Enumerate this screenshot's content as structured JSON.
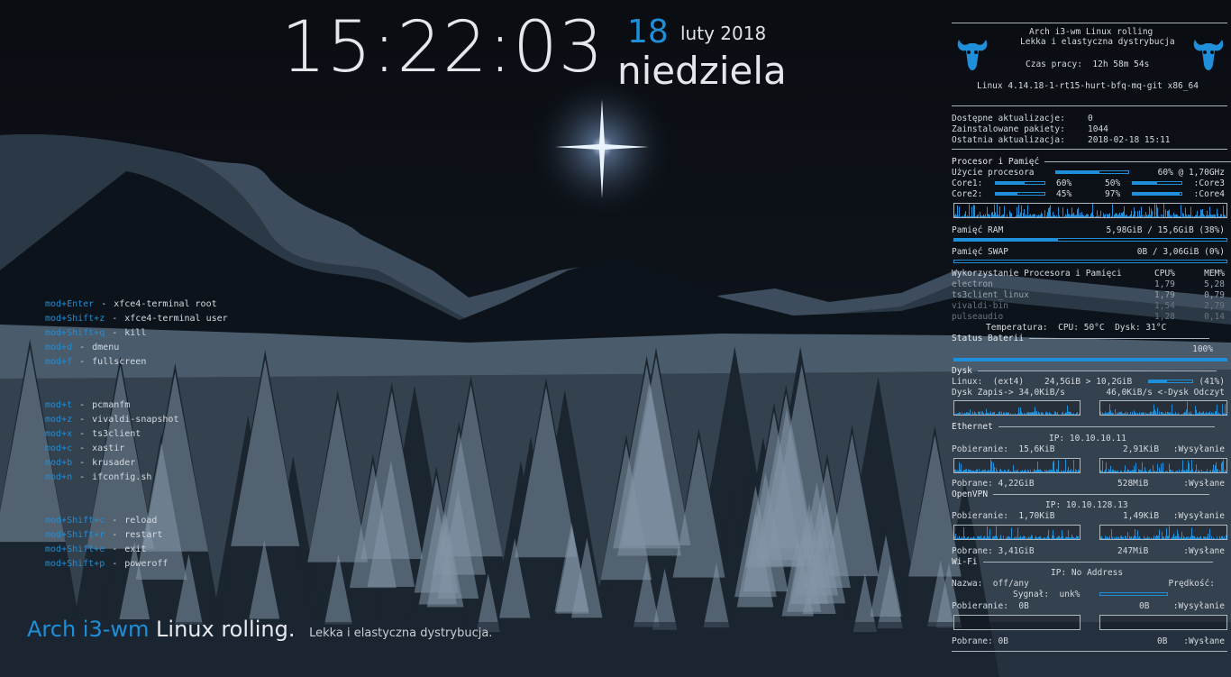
{
  "clock": {
    "time": "15:22:03",
    "day": "18",
    "month_year": "luty 2018",
    "weekday": "niedziela"
  },
  "keybinds": [
    {
      "key": "mod+Enter",
      "sep": "-",
      "desc": "xfce4-terminal root"
    },
    {
      "key": "mod+Shift+z",
      "sep": "-",
      "desc": "xfce4-terminal user"
    },
    {
      "key": "mod+Shift+q",
      "sep": "-",
      "desc": "kill"
    },
    {
      "key": "mod+d",
      "sep": "-",
      "desc": "dmenu"
    },
    {
      "key": "mod+f",
      "sep": "-",
      "desc": "fullscreen"
    },
    {
      "key": "mod+t",
      "sep": "-",
      "desc": "pcmanfm"
    },
    {
      "key": "mod+z",
      "sep": "-",
      "desc": "vivaldi-snapshot"
    },
    {
      "key": "mod+x",
      "sep": "-",
      "desc": "ts3client"
    },
    {
      "key": "mod+c",
      "sep": "-",
      "desc": "xastir"
    },
    {
      "key": "mod+b",
      "sep": "-",
      "desc": "krusader"
    },
    {
      "key": "mod+n",
      "sep": "-",
      "desc": "ifconfig.sh"
    },
    {
      "key": "mod+Shift+c",
      "sep": "-",
      "desc": "reload"
    },
    {
      "key": "mod+Shift+r",
      "sep": "-",
      "desc": "restart"
    },
    {
      "key": "mod+Shift+e",
      "sep": "-",
      "desc": "exit"
    },
    {
      "key": "mod+Shift+p",
      "sep": "-",
      "desc": "poweroff"
    }
  ],
  "bottom_title": {
    "a": "Arch i3-wm",
    "b": "Linux rolling.",
    "c": "Lekka i elastyczna dystrybucja."
  },
  "conky": {
    "header": {
      "line1": "Arch i3-wm Linux rolling",
      "line2": "Lekka i elastyczna dystrybucja",
      "uptime_label": "Czas pracy:",
      "uptime": "12h 58m 54s",
      "kernel": "Linux 4.14.18-1-rt15-hurt-bfq-mq-git x86_64"
    },
    "updates": {
      "available_label": "Dostępne aktualizacje:",
      "available": "0",
      "installed_label": "Zainstalowane pakiety:",
      "installed": "1044",
      "last_label": "Ostatnia aktualizacja:",
      "last": "2018-02-18 15:11"
    },
    "cpu": {
      "title": "Procesor i Pamięć",
      "usage_label": "Użycie procesora",
      "usage": "60% @ 1,70GHz",
      "usage_frac": 0.6,
      "core1_label": "Core1:",
      "core1": "60%",
      "core1_frac": 0.6,
      "core3": "50%",
      "core3_frac": 0.5,
      "core3_label": ":Core3",
      "core2_label": "Core2:",
      "core2": "45%",
      "core2_frac": 0.45,
      "core4": "97%",
      "core4_frac": 0.97,
      "core4_label": ":Core4"
    },
    "ram": {
      "label": "Pamięć RAM",
      "value": "5,98GiB / 15,6GiB (38%)",
      "frac": 0.38
    },
    "swap": {
      "label": "Pamięć SWAP",
      "value": "0B  / 3,06GiB (0%)",
      "frac": 0.0
    },
    "procs": {
      "title": "Wykorzystanie Procesora i Pamięci",
      "cpu_h": "CPU%",
      "mem_h": "MEM%",
      "rows": [
        {
          "name": "electron",
          "cpu": "1,79",
          "mem": "5,28"
        },
        {
          "name": "ts3client_linux",
          "cpu": "1,79",
          "mem": "0,79"
        },
        {
          "name": "vivaldi-bin",
          "cpu": "1,54",
          "mem": "2,79"
        },
        {
          "name": "pulseaudio",
          "cpu": "1,28",
          "mem": "0,14"
        }
      ],
      "temp_label": "Temperatura:",
      "cpu_temp_label": "CPU:",
      "cpu_temp": "50°C",
      "disk_temp_label": "Dysk:",
      "disk_temp": "31°C"
    },
    "battery": {
      "title": "Status Baterii",
      "value": "100%",
      "frac": 1.0
    },
    "disk": {
      "title": "Dysk",
      "linux_label": "Linux:",
      "fs": "(ext4)",
      "size": "24,5GiB > 10,2GiB",
      "pct": "(41%)",
      "frac": 0.41,
      "write_label": "Dysk Zapis->",
      "write": "34,0KiB/s",
      "read": "46,0KiB/s",
      "read_label": "<-Dysk Odczyt"
    },
    "ethernet": {
      "title": "Ethernet",
      "ip_label": "IP:",
      "ip": "10.10.10.11",
      "down_label": "Pobieranie:",
      "down": "15,6KiB",
      "up": "2,91KiB",
      "up_label": ":Wysyłanie",
      "total_down_label": "Pobrane:",
      "total_down": "4,22GiB",
      "total_up": "528MiB",
      "total_up_label": ":Wysłane"
    },
    "vpn": {
      "title": "OpenVPN",
      "ip_label": "IP:",
      "ip": "10.10.128.13",
      "down_label": "Pobieranie:",
      "down": "1,70KiB",
      "up": "1,49KiB",
      "up_label": ":Wysyłanie",
      "total_down_label": "Pobrane:",
      "total_down": "3,41GiB",
      "total_up": "247MiB",
      "total_up_label": ":Wysłane"
    },
    "wifi": {
      "title": "Wi-Fi",
      "ip_label": "IP:",
      "ip": "No Address",
      "name_label": "Nazwa:",
      "name": "off/any",
      "speed_label": "Prędkość:",
      "signal_label": "Sygnał:",
      "signal": "unk%",
      "down_label": "Pobieranie:",
      "down": "0B",
      "up": "0B",
      "up_label": ":Wysyłanie",
      "total_down_label": "Pobrane:",
      "total_down": "0B",
      "total_up": "0B",
      "total_up_label": ":Wysłane"
    }
  }
}
